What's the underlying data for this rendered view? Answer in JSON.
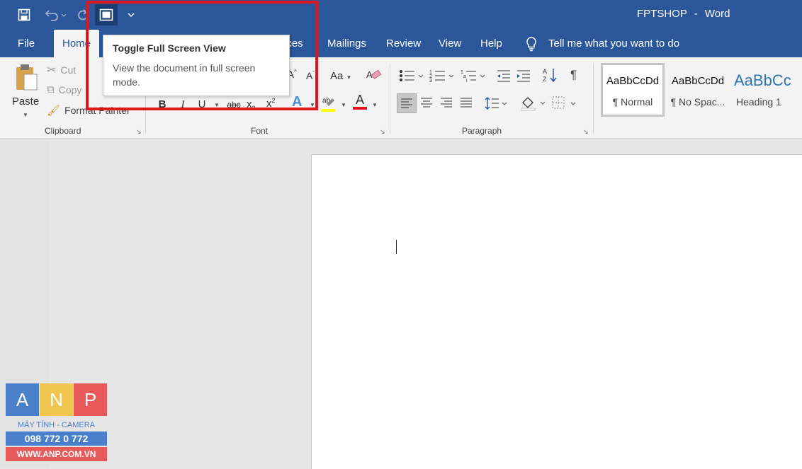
{
  "titlebar": {
    "document_name": "FPTSHOP",
    "separator": "-",
    "app_name": "Word"
  },
  "qat": {
    "save_icon": "save-icon",
    "undo_icon": "undo-icon",
    "redo_icon": "redo-icon",
    "fullscreen_icon": "fullscreen-icon",
    "customize_icon": "chevron-down-icon"
  },
  "tabs": [
    {
      "label": "File"
    },
    {
      "label": "Home",
      "active": true
    },
    {
      "label": "nces"
    },
    {
      "label": "Mailings"
    },
    {
      "label": "Review"
    },
    {
      "label": "View"
    },
    {
      "label": "Help"
    }
  ],
  "tell_me": {
    "placeholder": "Tell me what you want to do"
  },
  "clipboard": {
    "paste": "Paste",
    "cut": "Cut",
    "copy": "Copy",
    "format_painter": "Format Painter",
    "label": "Clipboard"
  },
  "font": {
    "label": "Font",
    "change_case": "Aa",
    "bold": "B",
    "italic": "I",
    "underline": "U",
    "strike": "abc",
    "subscript": "x",
    "sub_mark": "2",
    "superscript": "x",
    "sup_mark": "2",
    "text_effects": "A",
    "font_color": "A",
    "grow": "A",
    "shrink": "A"
  },
  "paragraph": {
    "label": "Paragraph",
    "pilcrow": "¶"
  },
  "styles": [
    {
      "sample": "AaBbCcDd",
      "name": "¶ Normal",
      "selected": true
    },
    {
      "sample": "AaBbCcDd",
      "name": "¶ No Spac..."
    },
    {
      "sample": "AaBbCc",
      "name": "Heading 1"
    }
  ],
  "tooltip": {
    "title": "Toggle Full Screen View",
    "description": "View the document in full screen mode."
  },
  "watermark": {
    "letters": [
      "A",
      "N",
      "P"
    ],
    "line1": "MÁY TÍNH - CAMERA",
    "phone": "098 772 0 772",
    "website": "WWW.ANP.COM.VN"
  },
  "colors": {
    "accent": "#2b579a",
    "highlight_box": "#e0161c",
    "font_color_bar": "#e81123",
    "highlight_bar": "#ffff00"
  }
}
